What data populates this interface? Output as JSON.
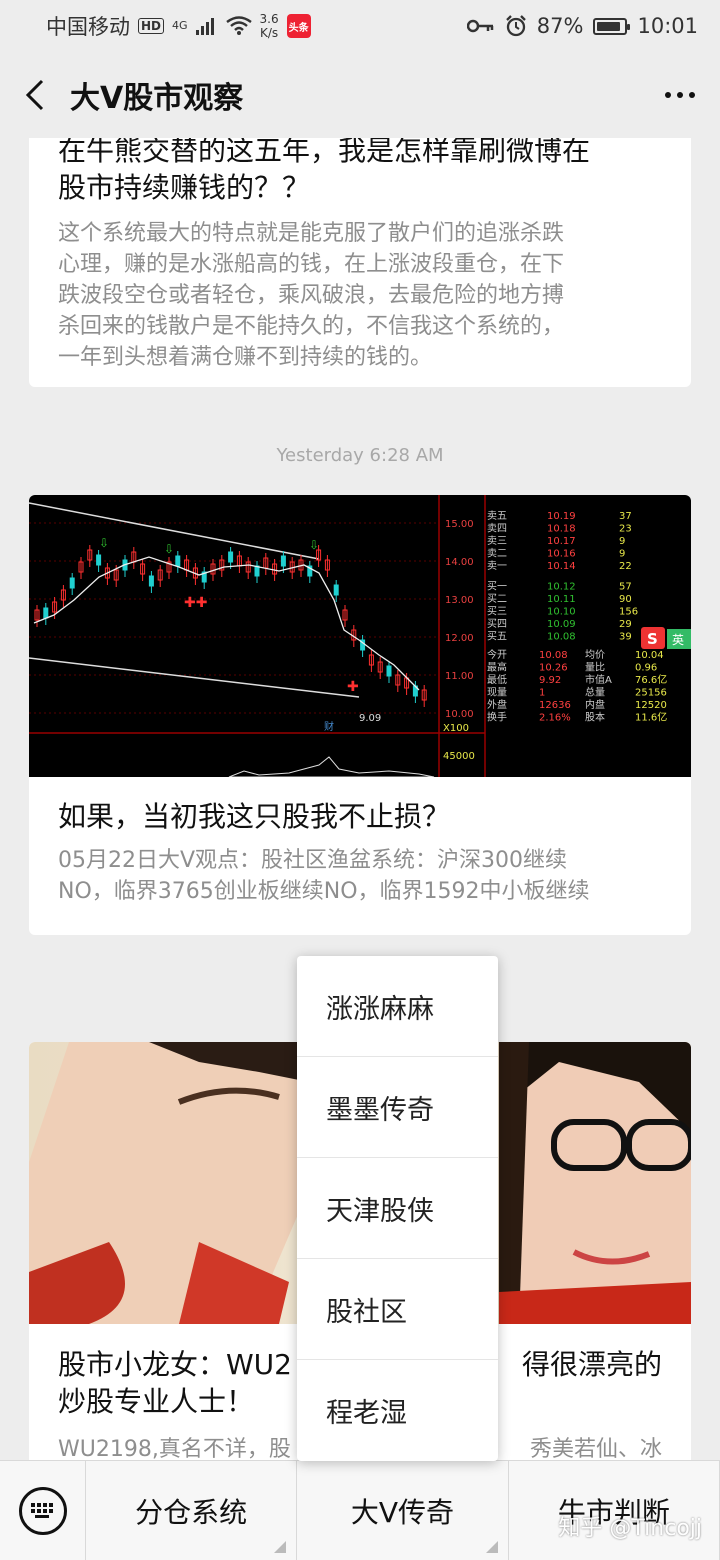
{
  "status_bar": {
    "carrier": "中国移动",
    "hd": "HD",
    "network": "4G",
    "speed_value": "3.6",
    "speed_unit": "K/s",
    "app_badge": "头条",
    "battery": "87%",
    "time": "10:01"
  },
  "header": {
    "title": "大V股市观察"
  },
  "articles": [
    {
      "title": "在牛熊交替的这五年，我是怎样靠刷微博在股市持续赚钱的？？",
      "title_visible_line1": "在牛熊交替的这五年，我是怎样靠刷微博在",
      "title_visible_line2": "股市持续赚钱的？？",
      "desc_line1": "这个系统最大的特点就是能克服了散户们的追涨杀跌",
      "desc_line2": "心理，赚的是水涨船高的钱，在上涨波段重仓，在下",
      "desc_line3": "跌波段空仓或者轻仓，乘风破浪，去最危险的地方搏",
      "desc_line4": "杀回来的钱散户是不能持久的，不信我这个系统的，",
      "desc_line5": "一年到头想着满仓赚不到持续的钱的。"
    },
    {
      "timestamp": "Yesterday 6:28 AM",
      "title": "如果，当初我这只股我不止损？",
      "desc_line1": "05月22日大V观点：股社区渔盆系统：沪深300继续",
      "desc_line2": "NO，临界3765创业板继续NO，临界1592中小板继续"
    },
    {
      "title_line1": "股市小龙女：WU2",
      "title_line1_tail": "得很漂亮的",
      "title_line2": "炒股专业人士！",
      "desc_line1": "WU2198,真名不详，股",
      "desc_line1_tail": "秀美若仙、冰"
    }
  ],
  "popup_menu": {
    "items": [
      "涨涨麻麻",
      "墨墨传奇",
      "天津股侠",
      "股社区",
      "程老湿"
    ]
  },
  "bottom_menu": {
    "tabs": [
      "分仓系统",
      "大V传奇",
      "牛市判断"
    ]
  },
  "watermark": "知乎 @Tincojj",
  "quote_panel": {
    "price_labels": [
      "15.00",
      "14.00",
      "13.00",
      "12.00",
      "11.00",
      "10.00"
    ],
    "sell": [
      [
        "卖五",
        "10.19",
        "37"
      ],
      [
        "卖四",
        "10.18",
        "23"
      ],
      [
        "卖三",
        "10.17",
        "9"
      ],
      [
        "卖二",
        "10.16",
        "9"
      ],
      [
        "卖一",
        "10.14",
        "22"
      ]
    ],
    "buy": [
      [
        "买一",
        "10.12",
        "57"
      ],
      [
        "买二",
        "10.11",
        "90"
      ],
      [
        "买三",
        "10.10",
        "156"
      ],
      [
        "买四",
        "10.09",
        "29"
      ],
      [
        "买五",
        "10.08",
        "39"
      ]
    ],
    "stats": [
      [
        "今开",
        "10.08",
        "均价",
        "10.04"
      ],
      [
        "最高",
        "10.26",
        "量比",
        "0.96"
      ],
      [
        "最低",
        "9.92",
        "市值A",
        "76.6亿"
      ],
      [
        "现量",
        "1",
        "总量",
        "25156"
      ],
      [
        "外盘",
        "12636",
        "内盘",
        "12520"
      ],
      [
        "换手",
        "2.16%",
        "股本",
        "11.6亿"
      ]
    ],
    "low_mark": "9.09",
    "vol_label": "45000",
    "scale_label": "X100",
    "badge": "S",
    "badge2": "英",
    "fin_label": "财"
  },
  "colors": {
    "background": "#ededed",
    "card": "#ffffff",
    "quote_yellow": "#e8e84a",
    "quote_green": "#30c030",
    "quote_red": "#ff3030"
  }
}
